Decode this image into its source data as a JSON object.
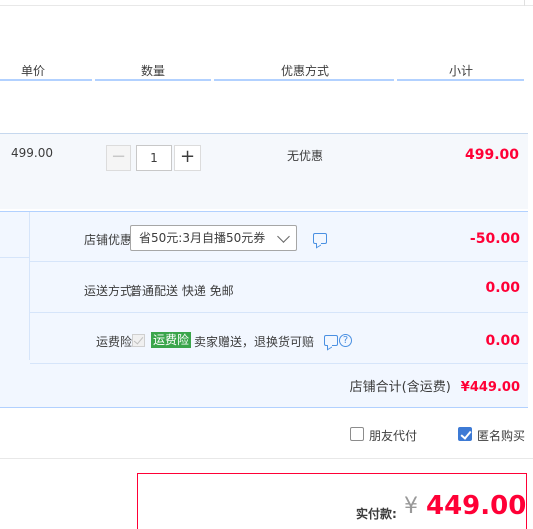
{
  "columns": {
    "unit_price": "单价",
    "quantity": "数量",
    "promotion": "优惠方式",
    "subtotal": "小计"
  },
  "item": {
    "price": "499.00",
    "quantity": "1",
    "minus_label": "−",
    "plus_label": "+",
    "promotion": "无优惠",
    "subtotal": "499.00"
  },
  "shop": {
    "coupon_label": "店铺优惠:",
    "coupon_selected": "省50元:3月自播50元券",
    "coupon_amount": "-50.00",
    "shipping_label": "运送方式:",
    "shipping_value": "普通配送 快递 免邮",
    "shipping_amount": "0.00",
    "insurance_label": "运费险:",
    "insurance_badge": "运费险",
    "insurance_text": "卖家赠送，退换货可赔",
    "insurance_amount": "0.00",
    "total_label": "店铺合计(含运费)",
    "total_amount": "¥449.00"
  },
  "order_options": {
    "friend_pay_label": "朋友代付",
    "friend_pay_checked": false,
    "anonymous_label": "匿名购买",
    "anonymous_checked": true
  },
  "payment": {
    "label": "实付款:",
    "currency": "¥",
    "amount": "449.00"
  },
  "colors": {
    "price_red": "#ff0036",
    "accent_blue": "#3d7ad5",
    "insurance_green": "#3aa54b"
  }
}
